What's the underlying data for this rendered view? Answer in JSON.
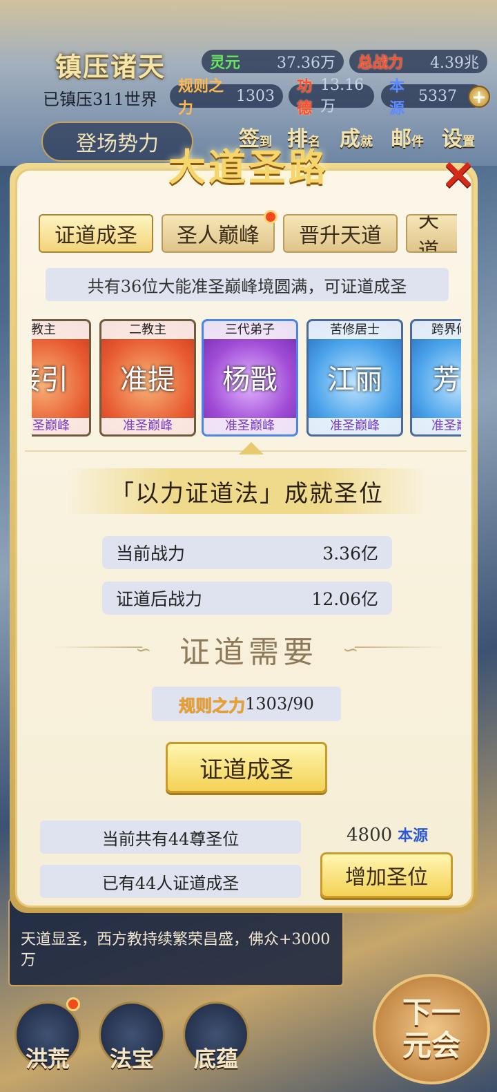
{
  "header": {
    "title": "镇压诸天",
    "suppressed": "已镇压311世界",
    "faction_button": "登场势力",
    "stats": {
      "lingyuan_label": "灵元",
      "lingyuan_value": "37.36万",
      "power_label": "总战力",
      "power_value": "4.39兆",
      "rule_label": "规则之力",
      "rule_value": "1303",
      "merit_label": "功德",
      "merit_value": "13.16万",
      "source_label": "本源",
      "source_value": "5337"
    },
    "menu": [
      {
        "main": "签",
        "sub": "到"
      },
      {
        "main": "排",
        "sub": "名"
      },
      {
        "main": "成",
        "sub": "就"
      },
      {
        "main": "邮",
        "sub": "件"
      },
      {
        "main": "设",
        "sub": "置"
      }
    ]
  },
  "dialog": {
    "title": "大道圣路",
    "tabs": [
      "证道成圣",
      "圣人巅峰",
      "晋升天道",
      "天道"
    ],
    "notice": "共有36位大能准圣巅峰境圆满，可证道成圣",
    "cards": [
      {
        "rank": "教主",
        "name": "接引",
        "level": "准圣巅峰",
        "style": "red"
      },
      {
        "rank": "二教主",
        "name": "准提",
        "level": "准圣巅峰",
        "style": "red"
      },
      {
        "rank": "三代弟子",
        "name": "杨戬",
        "level": "准圣巅峰",
        "style": "purple"
      },
      {
        "rank": "苦修居士",
        "name": "江丽",
        "level": "准圣巅峰",
        "style": "blue"
      },
      {
        "rank": "跨界修",
        "name": "芳",
        "level": "准圣巅峰",
        "style": "blue"
      }
    ],
    "method": "「以力证道法」成就圣位",
    "current_power_label": "当前战力",
    "current_power_value": "3.36亿",
    "after_power_label": "证道后战力",
    "after_power_value": "12.06亿",
    "requirement_title": "证道需要",
    "requirement_key": "规则之力",
    "requirement_value": "1303/90",
    "action_button": "证道成圣",
    "total_seats": "当前共有44尊圣位",
    "achieved": "已有44人证道成圣",
    "seat_cost": "4800",
    "seat_cost_unit": "本源",
    "add_seat_button": "增加圣位"
  },
  "bottom": {
    "event_text": "天道显圣，西方教持续繁荣昌盛，佛众+3000万",
    "nav": [
      "洪荒",
      "法宝",
      "底蕴"
    ],
    "next_button_line1": "下一",
    "next_button_line2": "元会"
  }
}
